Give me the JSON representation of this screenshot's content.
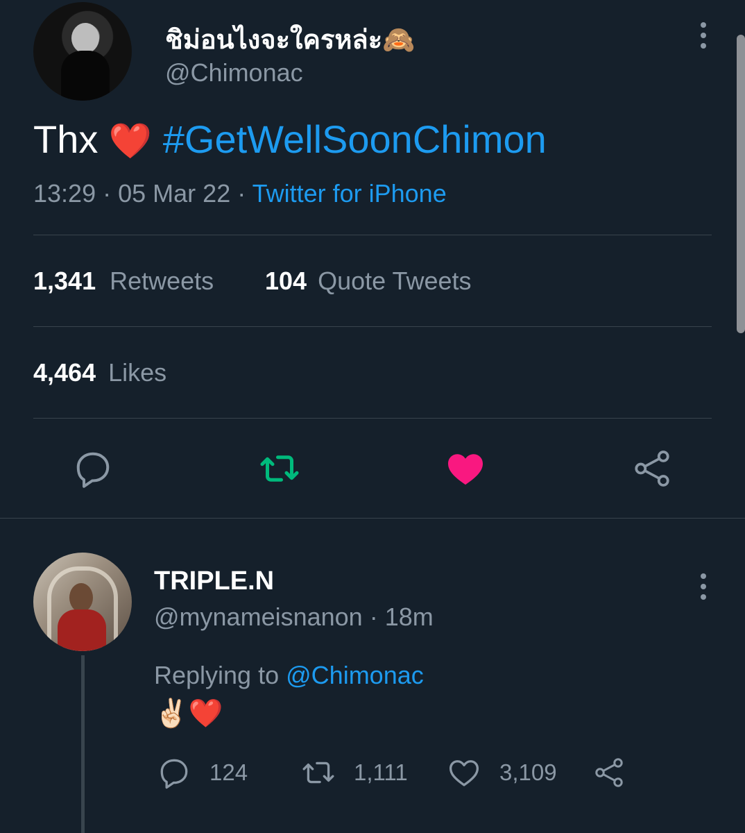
{
  "tweet": {
    "display_name": "ชิม่อนไงจะใครหล่ะ🙈",
    "handle": "@Chimonac",
    "text_plain": "Thx",
    "text_emoji": "❤️",
    "hashtag": "#GetWellSoonChimon",
    "time": "13:29",
    "separator1": "·",
    "date": "05 Mar 22",
    "separator2": "·",
    "source": "Twitter for iPhone",
    "retweets_count": "1,341",
    "retweets_label": "Retweets",
    "quotes_count": "104",
    "quotes_label": "Quote Tweets",
    "likes_count": "4,464",
    "likes_label": "Likes"
  },
  "reply": {
    "display_name": "TRIPLE.N",
    "handle": "@mynameisnanon",
    "separator": "·",
    "time_ago": "18m",
    "replying_prefix": "Replying to",
    "replying_to": "@Chimonac",
    "text": "✌🏻❤️",
    "reply_count": "124",
    "retweet_count": "1,111",
    "like_count": "3,109"
  },
  "colors": {
    "background": "#15202b",
    "link": "#1d9bf0",
    "secondary_text": "#8b98a5",
    "retweet_active": "#00ba7c",
    "like_active": "#f91880"
  },
  "icons": {
    "reply": "reply-icon",
    "retweet": "retweet-icon",
    "like": "heart-icon",
    "share": "share-icon",
    "more": "more-vertical-icon"
  }
}
